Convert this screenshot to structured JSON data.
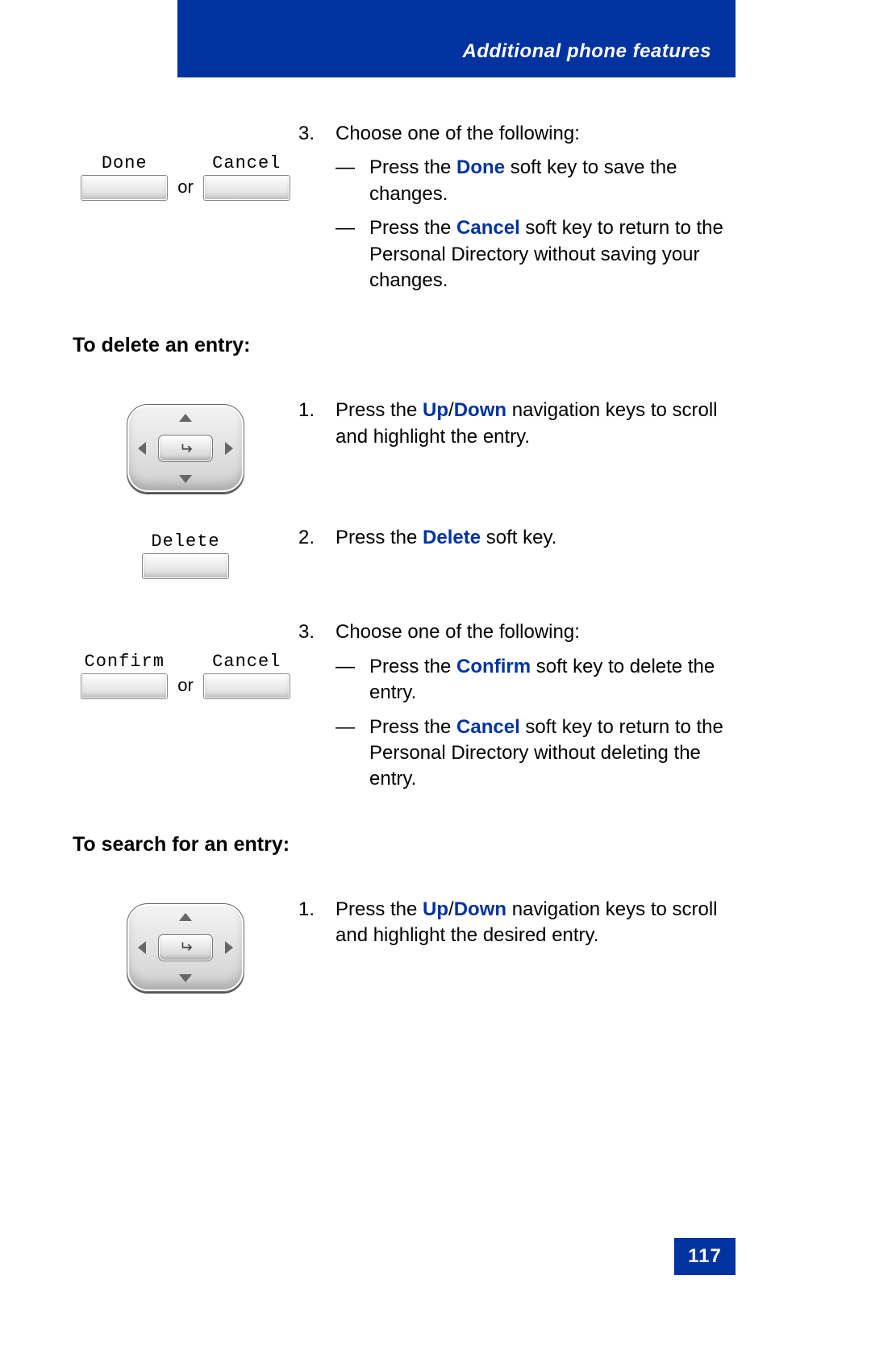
{
  "header": {
    "title": "Additional phone features"
  },
  "page_number": "117",
  "labels": {
    "or": "or",
    "dash": "—"
  },
  "softkeys": {
    "done": "Done",
    "cancel": "Cancel",
    "delete": "Delete",
    "confirm": "Confirm"
  },
  "step3_top": {
    "num": "3.",
    "lead": "Choose one of the following:",
    "a_pre": "Press the ",
    "a_key": "Done",
    "a_post": " soft key to save the changes.",
    "b_pre": "Press the ",
    "b_key": "Cancel",
    "b_post": " soft key to return to the Personal Directory without saving your changes."
  },
  "heading_delete": "To delete an entry:",
  "del_step1": {
    "num": "1.",
    "pre": "Press the ",
    "key1": "Up",
    "slash": "/",
    "key2": "Down",
    "post": " navigation keys to scroll and highlight the entry."
  },
  "del_step2": {
    "num": "2.",
    "pre": "Press the ",
    "key": "Delete",
    "post": " soft key."
  },
  "del_step3": {
    "num": "3.",
    "lead": "Choose one of the following:",
    "a_pre": "Press the ",
    "a_key": "Confirm",
    "a_post": " soft key to delete the entry.",
    "b_pre": "Press the ",
    "b_key": "Cancel",
    "b_post": " soft key to return to the Personal Directory without deleting the entry."
  },
  "heading_search": "To search for an entry:",
  "search_step1": {
    "num": "1.",
    "pre": "Press the ",
    "key1": "Up",
    "slash": "/",
    "key2": "Down",
    "post": " navigation keys to scroll and highlight the desired entry."
  }
}
